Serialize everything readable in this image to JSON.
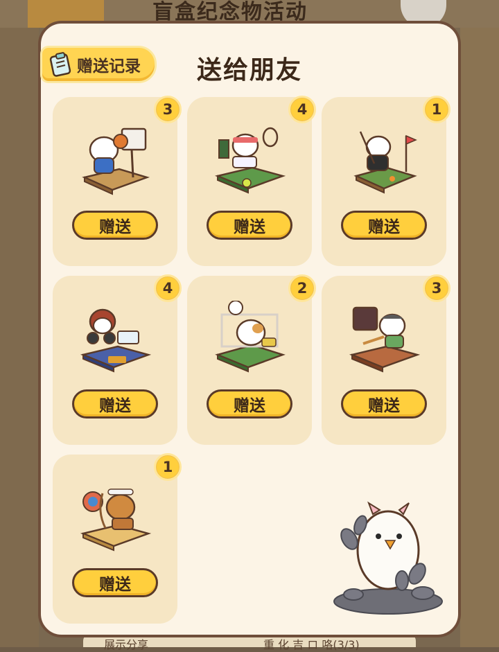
{
  "background": {
    "title": "盲盒纪念物活动",
    "bottom_left": "展示分享",
    "bottom_right": "重 化 吉 ロ 咯(3/3)"
  },
  "modal": {
    "title": "送给朋友",
    "record_button": "赠送记录",
    "items": [
      {
        "name": "basketball-cat",
        "count": "3",
        "button": "赠送"
      },
      {
        "name": "tennis-cat",
        "count": "4",
        "button": "赠送"
      },
      {
        "name": "golf-cat",
        "count": "1",
        "button": "赠送"
      },
      {
        "name": "boxing-cat",
        "count": "4",
        "button": "赠送"
      },
      {
        "name": "soccer-cat",
        "count": "2",
        "button": "赠送"
      },
      {
        "name": "baseball-cat",
        "count": "3",
        "button": "赠送"
      },
      {
        "name": "archery-cat",
        "count": "1",
        "button": "赠送"
      }
    ]
  },
  "colors": {
    "panel": "#fcf4e6",
    "card": "#f6e6c4",
    "button": "#ffcf3d",
    "border": "#6f4e3a"
  }
}
